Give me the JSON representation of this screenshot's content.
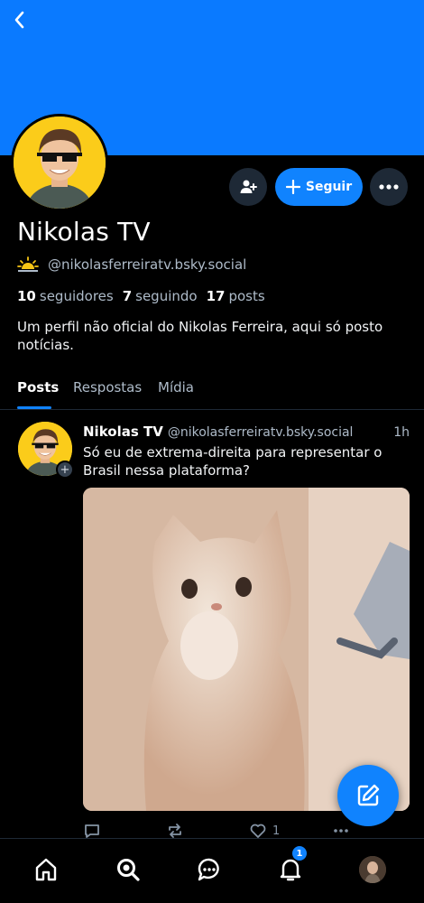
{
  "profile": {
    "display_name": "Nikolas TV",
    "handle": "@nikolasferreiratv.bsky.social",
    "followers_count": "10",
    "followers_label": "seguidores",
    "following_count": "7",
    "following_label": "seguindo",
    "posts_count": "17",
    "posts_label": "posts",
    "bio": "Um perfil não oficial do Nikolas Ferreira, aqui só posto notícias."
  },
  "header": {
    "banner_color": "#0a7aff",
    "follow_label": "Seguir"
  },
  "tabs": [
    {
      "label": "Posts",
      "active": true
    },
    {
      "label": "Respostas",
      "active": false
    },
    {
      "label": "Mídia",
      "active": false
    }
  ],
  "post": {
    "author": "Nikolas TV",
    "handle": "@nikolasferreiratv.bsky.social",
    "time": "1h",
    "text": "Só eu de extrema-direita para representar o Brasil nessa plataforma?",
    "like_count": "1"
  },
  "nav": {
    "notifications_badge": "1"
  },
  "colors": {
    "accent": "#1083fe",
    "background": "#000000",
    "muted_text": "#aebbc9"
  }
}
